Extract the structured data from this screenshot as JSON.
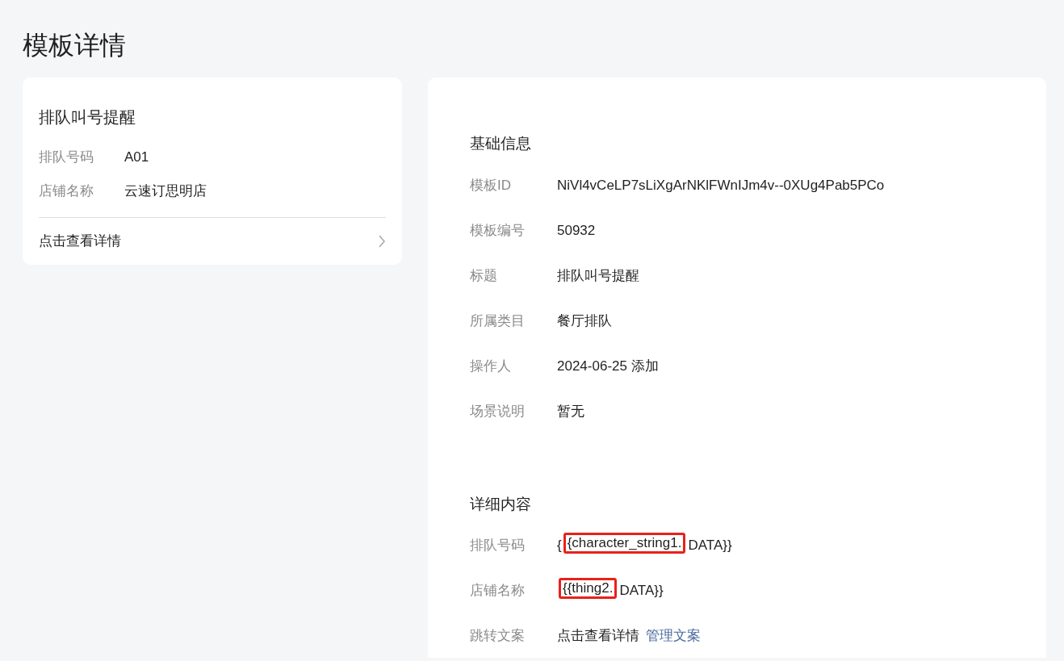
{
  "page_title": "模板详情",
  "preview": {
    "title": "排队叫号提醒",
    "fields": [
      {
        "label": "排队号码",
        "value": "A01"
      },
      {
        "label": "店铺名称",
        "value": "云速订思明店"
      }
    ],
    "link": "点击查看详情"
  },
  "basic_info": {
    "heading": "基础信息",
    "rows": [
      {
        "label": "模板ID",
        "value": "NiVl4vCeLP7sLiXgArNKlFWnIJm4v--0XUg4Pab5PCo"
      },
      {
        "label": "模板编号",
        "value": "50932"
      },
      {
        "label": "标题",
        "value": "排队叫号提醒"
      },
      {
        "label": "所属类目",
        "value": "餐厅排队"
      },
      {
        "label": "操作人",
        "value": "2024-06-25 添加"
      },
      {
        "label": "场景说明",
        "value": "暂无"
      }
    ]
  },
  "details": {
    "heading": "详细内容",
    "rows": [
      {
        "label": "排队号码",
        "kind": "segments",
        "segments": [
          {
            "text": "{",
            "highlighted": false
          },
          {
            "text": "{character_string1.",
            "highlighted": true
          },
          {
            "text": "DATA}}",
            "highlighted": false
          }
        ]
      },
      {
        "label": "店铺名称",
        "kind": "segments",
        "segments": [
          {
            "text": "{{thing2.",
            "highlighted": true
          },
          {
            "text": "DATA}}",
            "highlighted": false
          }
        ]
      },
      {
        "label": "跳转文案",
        "kind": "link",
        "value": "点击查看详情",
        "link": "管理文案"
      }
    ]
  }
}
